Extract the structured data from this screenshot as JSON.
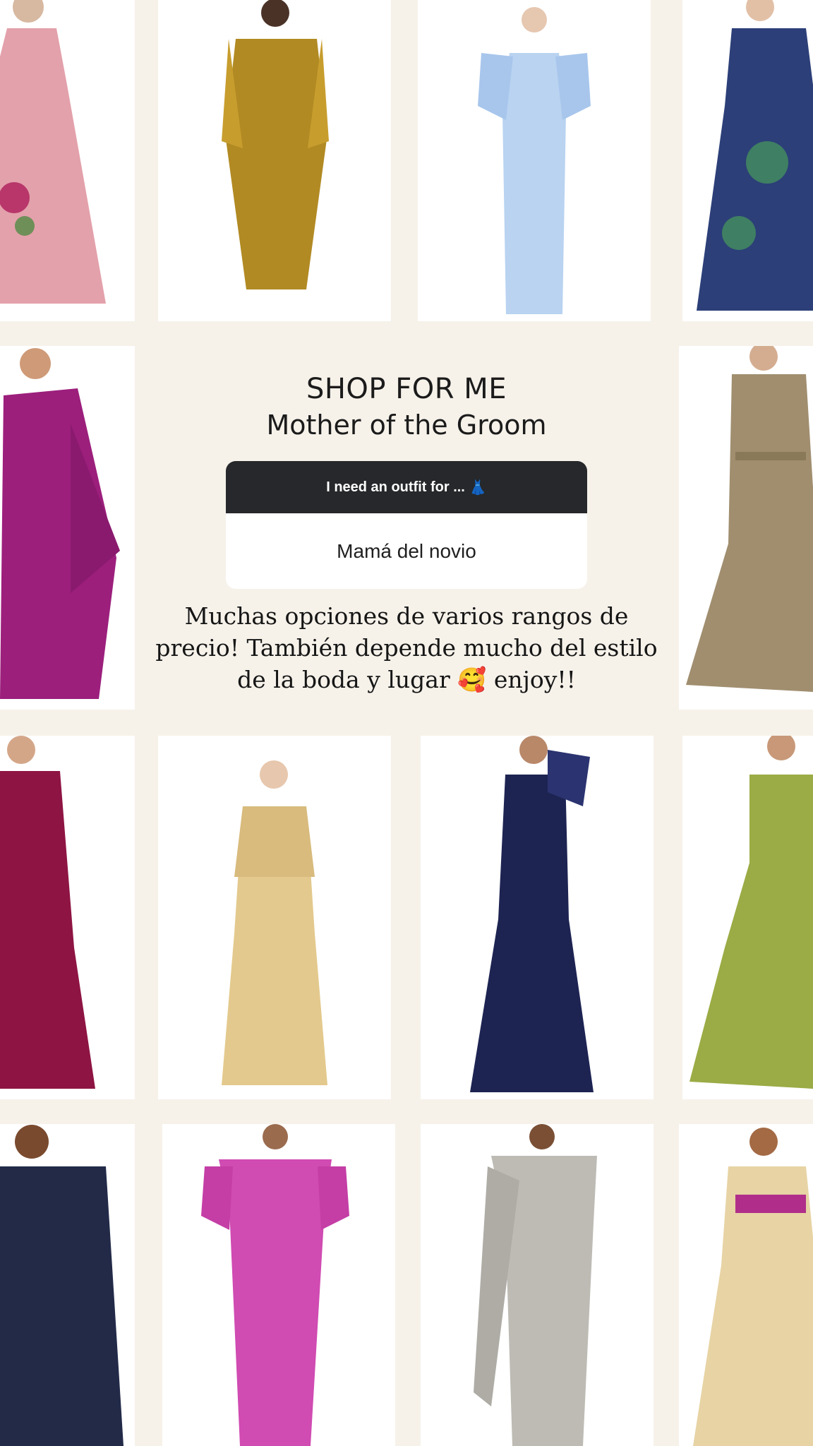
{
  "story": {
    "title": "SHOP FOR ME",
    "subtitle": "Mother of the Groom",
    "question": {
      "prompt": "I need an outfit for ...",
      "prompt_emoji": "👗",
      "answer": "Mamá del novio"
    },
    "note": {
      "text": "Muchas opciones de varios rangos de precio! También depende mucho del estilo de la boda y lugar",
      "emoji": "🥰",
      "tail": "enjoy!!"
    }
  },
  "colors": {
    "background": "#f6f2ea",
    "card_header": "#26282b",
    "dresses": [
      "#e3a1ab",
      "#b18a23",
      "#b9d3f1",
      "#2c3f78",
      "#9c1f7c",
      "#a08e6f",
      "#8e1443",
      "#e3c98d",
      "#1d2452",
      "#9bab45",
      "#222a48",
      "#d04bb2",
      "#bdbbb4",
      "#e7d3a4"
    ]
  }
}
